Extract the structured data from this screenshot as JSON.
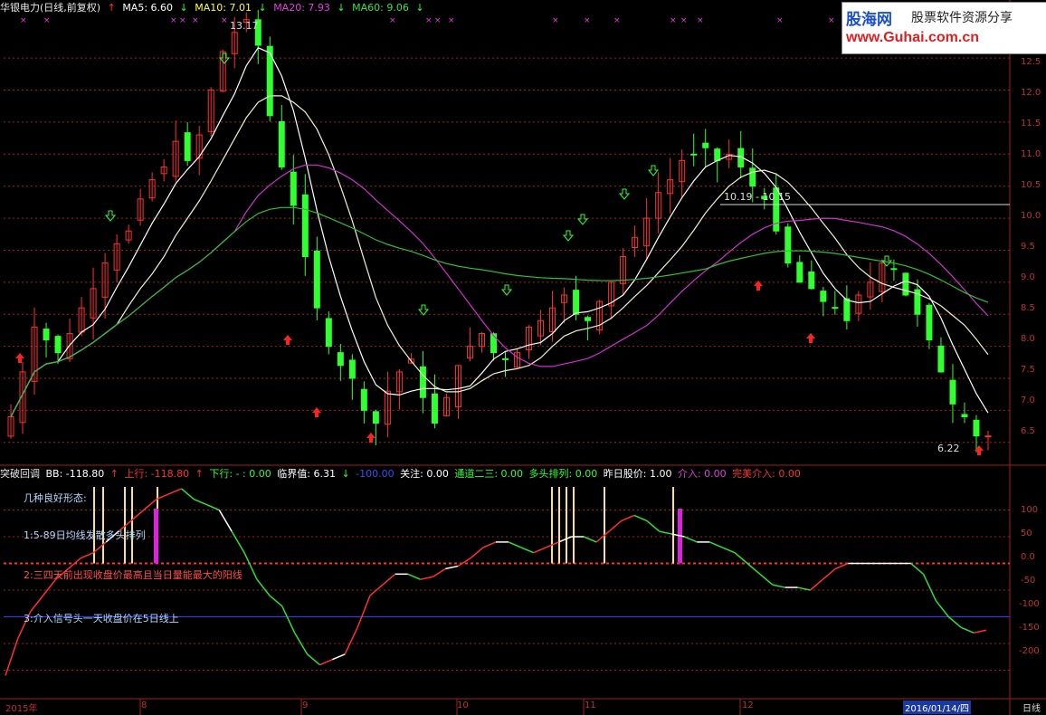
{
  "main_header": {
    "stock_name": "华银电力(日线,前复权)",
    "ma5": "MA5: 6.60",
    "ma10": "MA10: 7.01",
    "ma20": "MA20: 7.93",
    "ma60": "MA60: 9.06"
  },
  "watermark": {
    "brand": "股海网",
    "slogan": "股票软件资源分享",
    "url": "www.Guhai.com.cn"
  },
  "price_annotations": {
    "high": "13.17",
    "low": "6.22",
    "range_label": "10.19 - 10.15"
  },
  "price_axis": {
    "ticks": [
      "12.5",
      "12.0",
      "11.5",
      "11.0",
      "10.5",
      "10.0",
      "9.5",
      "9.0",
      "8.5",
      "8.0",
      "7.5",
      "7.0",
      "6.5"
    ]
  },
  "indicator_header": {
    "name": "突破回调",
    "bb": "BB: -118.80",
    "shangxing": "上行: -118.80",
    "xiaxing": "下行: - : 0.00",
    "linjie": "临界值: 6.31",
    "minus100": "-100.00",
    "guanzhu": "关注: 0.00",
    "tongdao": "通道二三: 0.00",
    "duotou": "多头排列: 0.00",
    "zuori": "昨日股价: 1.00",
    "jieru": "介入: 0.00",
    "wanmei": "完美介入: 0.00"
  },
  "indicator_notes": {
    "title": "几种良好形态:",
    "item1": "1:5-89日均线发散多头排列",
    "item2": "2:三四天前出现收盘价最高且当日量能最大的阳线",
    "item3": "3:介入信号头一天收盘价在5日线上"
  },
  "indicator_axis": {
    "ticks": [
      "100",
      "50",
      "0.0",
      "-50",
      "-100",
      "-150",
      "-200"
    ]
  },
  "time_axis": {
    "labels": [
      "2015年",
      "8",
      "9",
      "10",
      "11",
      "12"
    ],
    "current_date": "2016/01/14/四",
    "period": "日线"
  },
  "colors": {
    "up": "#ff3030",
    "down": "#30ff30",
    "ma5": "#ffffff",
    "ma10": "#ffff40",
    "ma20": "#d030d0",
    "ma60": "#30c030",
    "grid": "#a02020",
    "signal_bar": "#ffe080",
    "magenta_bar": "#e020e0"
  },
  "chart_data": {
    "type": "candlestick",
    "title": "华银电力(日线,前复权)",
    "y_range": [
      6.2,
      12.7
    ],
    "close_path": [
      6.9,
      7.6,
      8.3,
      8.1,
      7.9,
      8.2,
      8.6,
      8.9,
      9.3,
      9.6,
      9.8,
      10.3,
      10.6,
      10.8,
      11.2,
      10.9,
      11.3,
      12.0,
      12.6,
      12.9,
      13.1,
      12.7,
      11.6,
      10.8,
      10.2,
      9.4,
      8.6,
      8.0,
      7.7,
      7.5,
      7.0,
      6.8,
      7.3,
      7.6,
      7.8,
      7.2,
      6.8,
      7.2,
      7.7,
      8.0,
      8.2,
      7.9,
      7.8,
      7.9,
      8.3,
      8.4,
      8.6,
      8.8,
      8.5,
      8.4,
      8.7,
      9.0,
      9.4,
      9.7,
      10.0,
      10.4,
      10.6,
      10.9,
      11.0,
      11.1,
      10.9,
      11.0,
      10.8,
      10.5,
      10.3,
      9.8,
      9.3,
      9.0,
      8.9,
      8.7,
      8.6,
      8.4,
      8.8,
      9.0,
      9.3,
      9.2,
      8.8,
      8.5,
      8.1,
      7.6,
      7.1,
      6.9,
      6.6,
      6.6
    ],
    "ma_series": [
      "MA5",
      "MA10",
      "MA20",
      "MA60"
    ],
    "indicator": {
      "name": "突破回调",
      "range": [
        -250,
        150
      ],
      "values": [
        -210,
        -140,
        -90,
        -60,
        -30,
        -10,
        10,
        20,
        40,
        60,
        80,
        100,
        120,
        130,
        140,
        120,
        110,
        100,
        60,
        20,
        -30,
        -60,
        -80,
        -130,
        -170,
        -190,
        -180,
        -170,
        -120,
        -60,
        -40,
        -20,
        -20,
        -30,
        -25,
        -10,
        -5,
        10,
        30,
        40,
        40,
        30,
        20,
        30,
        40,
        50,
        50,
        40,
        60,
        80,
        90,
        80,
        60,
        55,
        50,
        40,
        40,
        30,
        20,
        0,
        -20,
        -40,
        -45,
        -45,
        -50,
        -30,
        -10,
        0,
        0,
        0,
        0,
        0,
        0,
        -20,
        -70,
        -100,
        -120,
        -130,
        -125
      ]
    }
  }
}
